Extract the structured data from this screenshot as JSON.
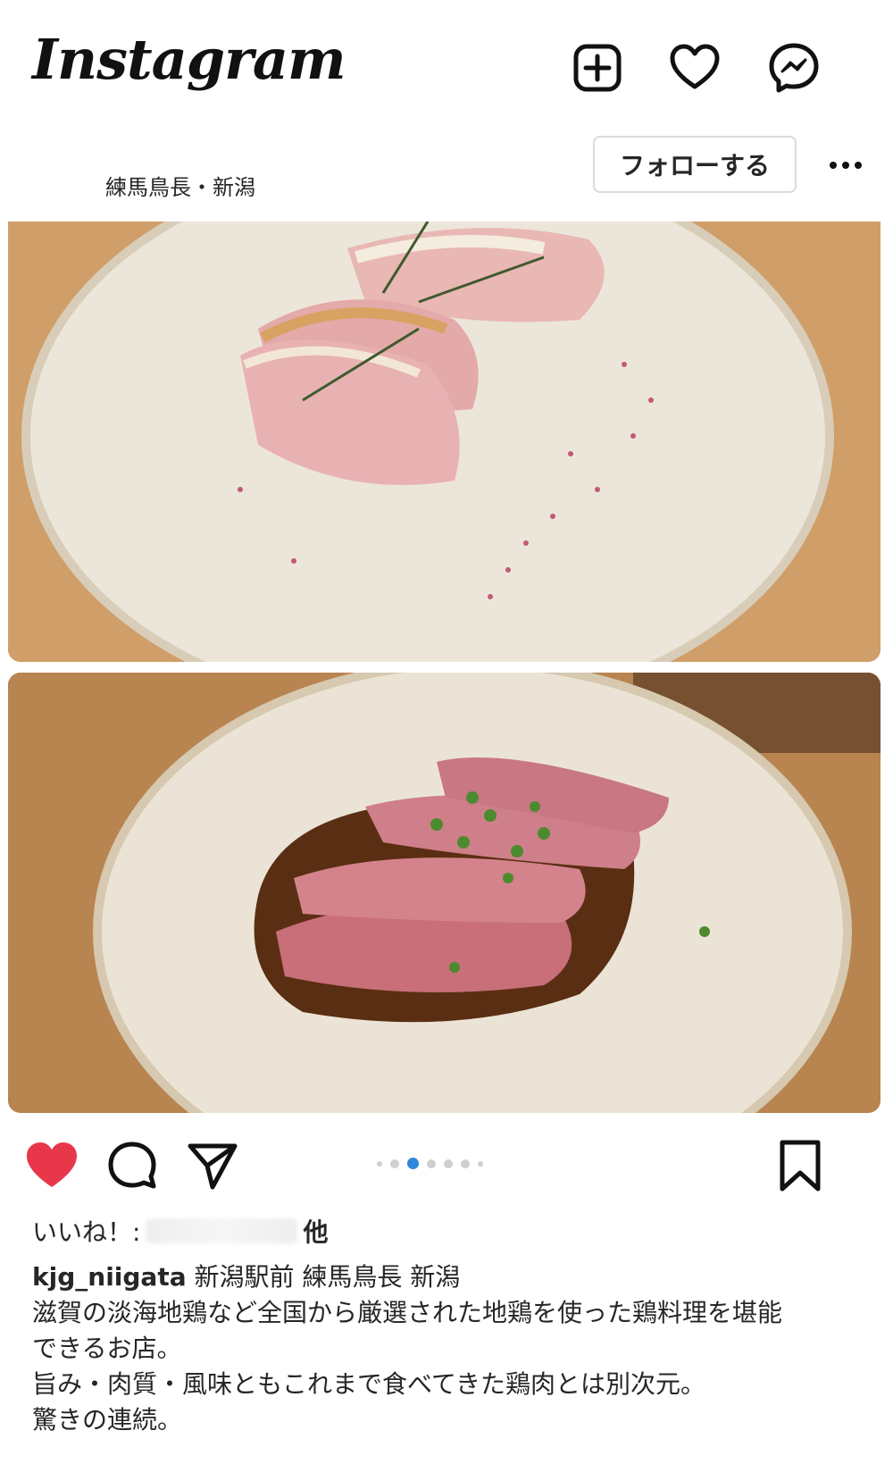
{
  "header": {
    "logo": "Instagram",
    "icons": [
      "new-post-icon",
      "heart-icon",
      "messenger-icon"
    ]
  },
  "post": {
    "location": "練馬鳥長・新潟",
    "follow_label": "フォローする",
    "carousel": {
      "current": 3,
      "total": 7
    },
    "liked": true,
    "likes_prefix": "いいね！:",
    "likes_suffix": "他",
    "username": "kjg_niigata",
    "title_text": " 新潟駅前 練馬鳥長 新潟",
    "caption_lines": [
      "滋賀の淡海地鶏など全国から厳選された地鶏を使った鶏料理を堪能",
      "できるお店。",
      "旨み・肉質・風味ともこれまで食べてきた鶏肉とは別次元。",
      "驚きの連続。"
    ]
  },
  "colors": {
    "like_red": "#e8374a",
    "dot_active": "#2e86de",
    "text": "#262626"
  }
}
